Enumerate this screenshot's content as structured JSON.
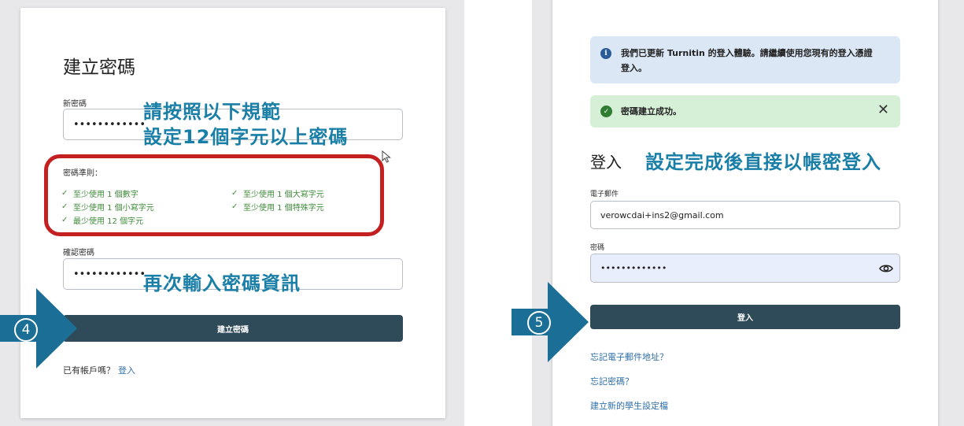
{
  "left": {
    "title": "建立密碼",
    "new_password_label": "新密碼",
    "new_password_value": "••••••••••••",
    "overlay_rules_line1": "請按照以下規範",
    "overlay_rules_line2": "設定12個字元以上密碼",
    "rules_title": "密碼準則：",
    "rules": [
      "至少使用 1 個數字",
      "至少使用 1 個大寫字元",
      "至少使用 1 個小寫字元",
      "至少使用 1 個特殊字元",
      "最少使用 12 個字元"
    ],
    "confirm_label": "確認密碼",
    "confirm_value": "••••••••••••",
    "overlay_confirm": "再次輸入密碼資訊",
    "create_button": "建立密碼",
    "have_account": "已有帳戶嗎？",
    "signin_link": "登入",
    "step_number": "4"
  },
  "right": {
    "info_text": "我們已更新 Turnitin 的登入體驗。請繼續使用您現有的登入憑證登入。",
    "success_text": "密碼建立成功。",
    "close_glyph": "✕",
    "title": "登入",
    "overlay_text": "設定完成後直接以帳密登入",
    "email_label": "電子郵件",
    "email_value": "verowcdai+ins2@gmail.com",
    "password_label": "密碼",
    "password_value": "•••••••••••••",
    "signin_button": "登入",
    "forgot_email": "忘記電子郵件地址？",
    "forgot_password": "忘記密碼？",
    "create_profile": "建立新的學生設定檔",
    "step_number": "5"
  },
  "colors": {
    "primary_button": "#2f4a59",
    "overlay_text": "#1a7fa7",
    "highlight_border": "#c4201f",
    "rule_green": "#3f8b3a",
    "arrow_blue": "#1b6f96",
    "info_bg": "#dbe7f5",
    "success_bg": "#d6efd7"
  }
}
